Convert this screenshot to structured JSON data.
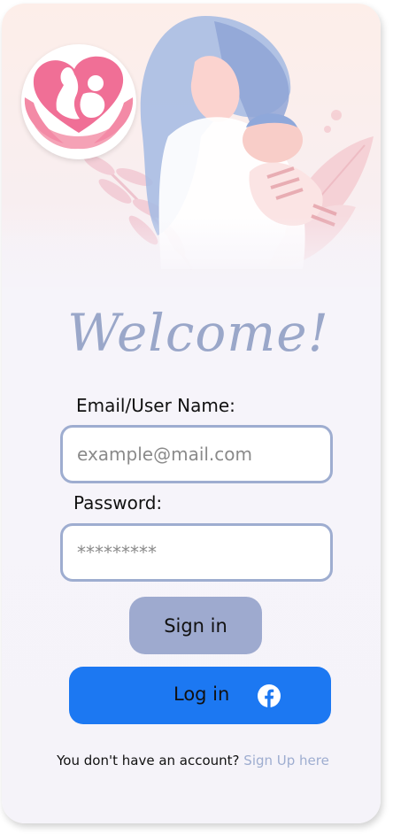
{
  "header": {
    "welcome_title": "Welcome!"
  },
  "icons": {
    "logo": "mother-child-heart-icon",
    "facebook": "facebook-icon"
  },
  "colors": {
    "accent": "#9eadd0",
    "facebook_blue": "#1c78f2",
    "signin_button": "#9eaacf",
    "logo_pink": "#f06f96"
  },
  "form": {
    "email_label": "Email/User Name:",
    "email_placeholder": "example@mail.com",
    "email_value": "",
    "password_label": "Password:",
    "password_placeholder": "*********",
    "password_value": "",
    "signin_label": "Sign in",
    "facebook_label": "Log in"
  },
  "footer": {
    "prompt": "You don't have an account?",
    "signup_link": "Sign Up here"
  }
}
